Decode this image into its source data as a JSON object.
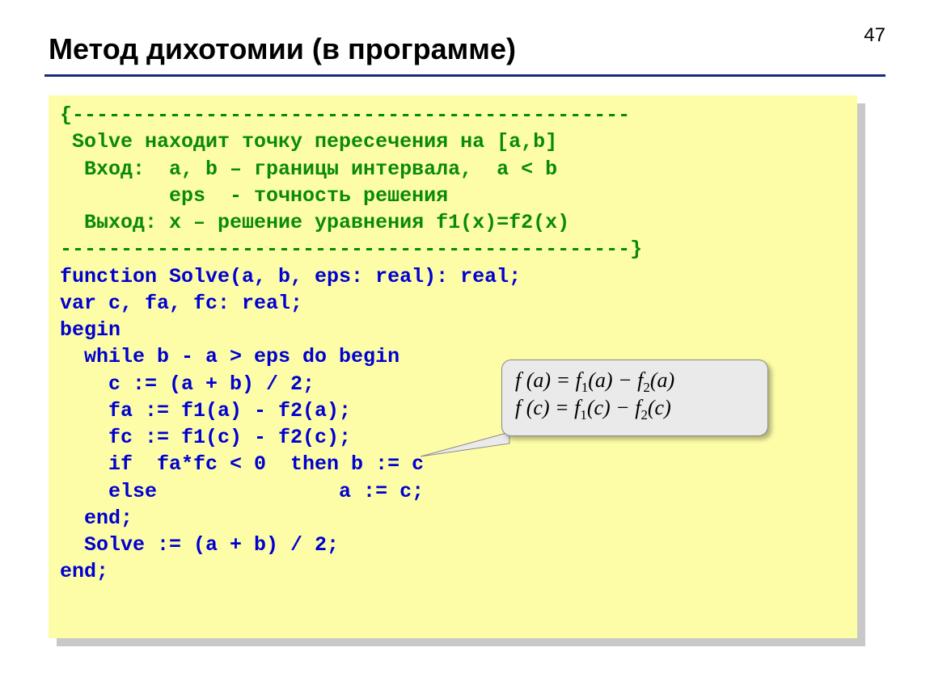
{
  "page_number": "47",
  "title": "Метод дихотомии (в программе)",
  "comment_lines": [
    "{----------------------------------------------",
    " Solve находит точку пересечения на [a,b]",
    "  Вход:  a, b – границы интервала,  a < b",
    "         eps  - точность решения",
    "  Выход: x – решение уравнения f1(x)=f2(x)",
    "-----------------------------------------------}"
  ],
  "code_lines": [
    "function Solve(a, b, eps: real): real;",
    "var c, fa, fc: real;",
    "begin",
    "  while b - a > eps do begin",
    "    c := (a + b) / 2;",
    "    fa := f1(a) - f2(a);",
    "    fc := f1(c) - f2(c);",
    "    if  fa*fc < 0  then b := c",
    "    else               a := c;",
    "  end;",
    "  Solve := (a + b) / 2;",
    "end;"
  ],
  "callout": {
    "line1_prefix": "f (a) = f",
    "line1_sub1": "1",
    "line1_mid": "(a) − f",
    "line1_sub2": "2",
    "line1_suffix": "(a)",
    "line2_prefix": "f (c) = f",
    "line2_sub1": "1",
    "line2_mid": "(c) − f",
    "line2_sub2": "2",
    "line2_suffix": "(c)"
  }
}
